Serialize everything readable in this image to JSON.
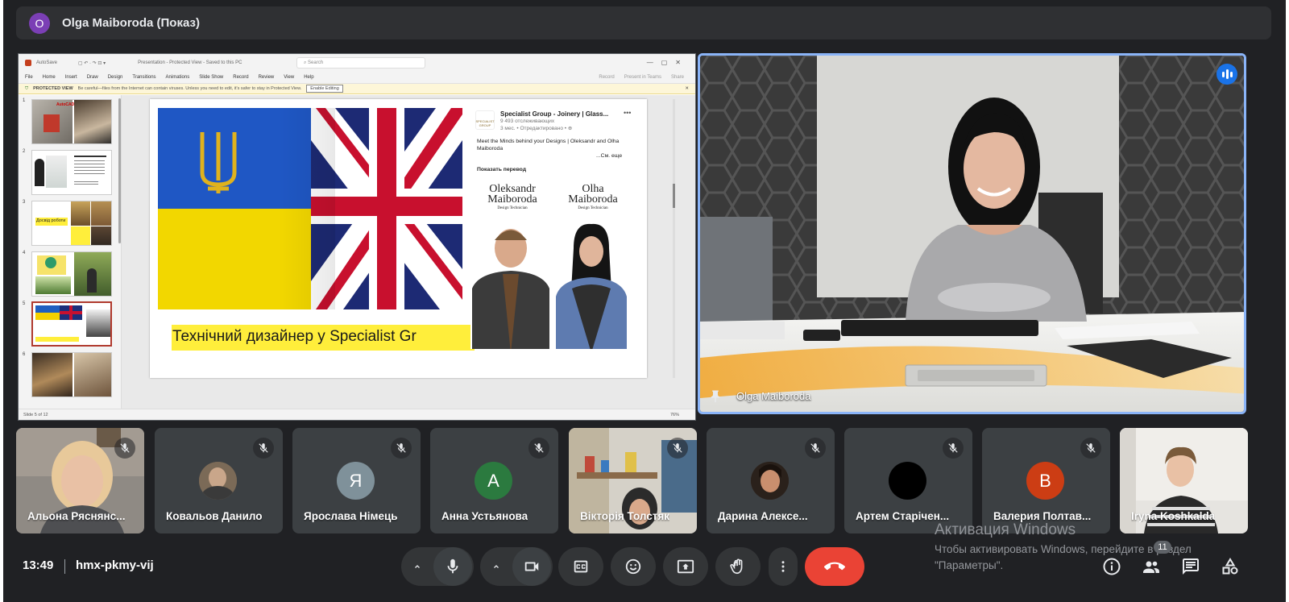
{
  "presenter": {
    "avatar_letter": "O",
    "title": "Olga Maiboroda (Показ)"
  },
  "presentation": {
    "titlebar": {
      "autosave": "AutoSave",
      "filename": "Presentation - Protected View - Saved to this PC",
      "search_placeholder": "Search"
    },
    "menu": [
      "File",
      "Home",
      "Insert",
      "Draw",
      "Design",
      "Transitions",
      "Animations",
      "Slide Show",
      "Record",
      "Review",
      "View",
      "Help"
    ],
    "menu_right": [
      "Record",
      "Present in Teams",
      "Share"
    ],
    "protected_view": {
      "label": "PROTECTED VIEW",
      "text": "Be careful—files from the Internet can contain viruses. Unless you need to edit, it's safer to stay in Protected View.",
      "button": "Enable Editing"
    },
    "thumbnails": [
      {
        "num": "1",
        "caption": "AutoCAD"
      },
      {
        "num": "2",
        "caption": ""
      },
      {
        "num": "3",
        "caption": "Досвід роботи"
      },
      {
        "num": "4",
        "caption": ""
      },
      {
        "num": "5",
        "caption": ""
      },
      {
        "num": "6",
        "caption": ""
      }
    ],
    "slide": {
      "title": "Технічний дизайнер у Specialist Gr",
      "linkedin": {
        "logo_text": "SPECIALIST GROUP",
        "company": "Specialist Group - Joinery | Glass...",
        "followers": "9 493 отслеживающих",
        "meta": "3 мес. • Отредактировано • ⊕",
        "more": "•••",
        "post": "Meet the Minds behind your Designs | Oleksandr and Olha Maiboroda",
        "see_more": "...См. еще",
        "translate": "Показать перевод",
        "person1": {
          "first": "Oleksandr",
          "last": "Maiboroda",
          "role": "Design Technician"
        },
        "person2": {
          "first": "Olha",
          "last": "Maiboroda",
          "role": "Design Technician"
        }
      }
    },
    "status_left": "Slide 5 of 12",
    "zoom": "76%"
  },
  "main_video": {
    "name": "Olga Maiboroda"
  },
  "participants": [
    {
      "name": "Альона Ряснянс...",
      "kind": "photo"
    },
    {
      "name": "Ковальов Данило",
      "kind": "photo-avatar"
    },
    {
      "name": "Ярослава Німець",
      "kind": "letter",
      "letter": "Я",
      "color": "#7f919a"
    },
    {
      "name": "Анна Устьянова",
      "kind": "letter",
      "letter": "A",
      "color": "#2b7a3f"
    },
    {
      "name": "Вікторія Толстяк",
      "kind": "photo"
    },
    {
      "name": "Дарина Алексе...",
      "kind": "photo-avatar"
    },
    {
      "name": "Артем Старічен...",
      "kind": "photo-avatar"
    },
    {
      "name": "Валерия Полтав...",
      "kind": "letter",
      "letter": "B",
      "color": "#cc3d14"
    },
    {
      "name": "Iryna Koshkalda",
      "kind": "photo"
    }
  ],
  "windows_watermark": {
    "title": "Активация Windows",
    "subtitle": "Чтобы активировать Windows, перейдите в раздел \"Параметры\"."
  },
  "participant_count": "11",
  "bottom_bar": {
    "time": "13:49",
    "meeting_code": "hmx-pkmy-vij"
  },
  "colors": {
    "accent": "#8ab4f8",
    "hangup": "#ea4335",
    "speaking": "#1a73e8",
    "bg": "#202124"
  }
}
